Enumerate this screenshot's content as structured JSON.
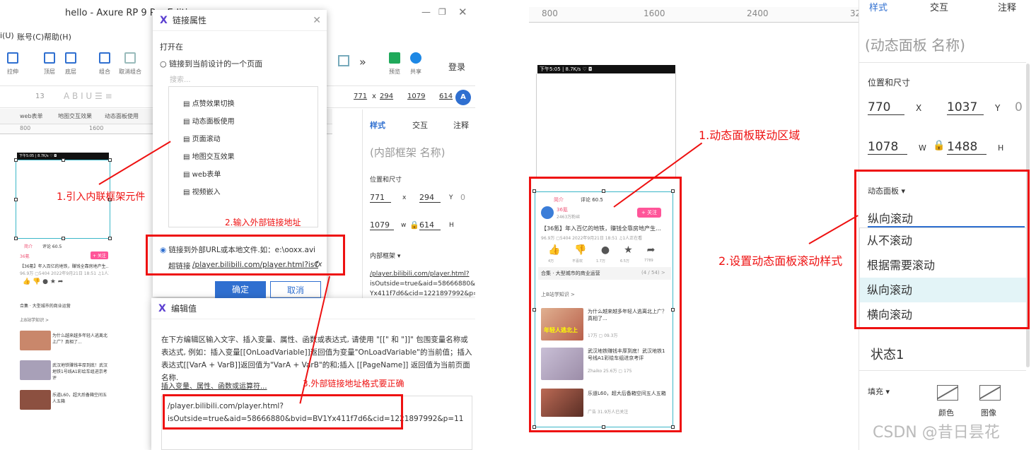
{
  "left": {
    "window_title": "hello - Axure RP 9 Pro Editi",
    "menu": [
      "i(U)",
      "账号(C)",
      "帮助(H)"
    ],
    "toolbar": [
      "拉伸",
      "顶层",
      "底层",
      "组合",
      "取消组合",
      "预览",
      "共享"
    ],
    "login": "登录",
    "fmt": {
      "size": "13",
      "x": "771",
      "y": "294",
      "w": "1079",
      "h": "614"
    },
    "tabs": [
      "web表单",
      "地图交互效果",
      "动态面板使用"
    ],
    "ruler": [
      "800",
      "1600"
    ],
    "props": {
      "tabs": [
        "样式",
        "交互",
        "注释"
      ],
      "name_placeholder": "(内部框架 名称)",
      "pos_label": "位置和尺寸",
      "x": "771",
      "x_lbl": "x",
      "y": "294",
      "y_lbl": "Y",
      "zero": "0",
      "w": "1079",
      "w_lbl": "w",
      "h": "614",
      "h_lbl": "H",
      "inner_label": "内部框架 ▾",
      "url_lines": [
        "/player.bilibili.com/player.html?",
        "isOutside=true&aid=58666880&bvid=E",
        "Yx411f7d6&cid=1221897992&p=11"
      ]
    },
    "link_dialog": {
      "title": "链接属性",
      "open_in": "打开在",
      "opt1": "链接到当前设计的一个页面",
      "search": "搜索...",
      "pages": [
        "点赞效果切换",
        "动态面板使用",
        "页面滚动",
        "地图交互效果",
        "web表单",
        "视频嵌入"
      ],
      "opt2": "链接到外部URL或本地文件.如：e:\\ooxx.avi",
      "hyperlink_label": "超链接",
      "hyperlink_value": "/player.bilibili.com/player.html?isOutside",
      "fx": "fx",
      "ok": "确定",
      "cancel": "取消"
    },
    "edit_dialog": {
      "title": "编辑值",
      "desc": "在下方编辑区输入文字、插入变量、属性、函数或表达式, 请使用 \"[[\" 和 \"]]\" 包围变量名称或表达式, 例如：插入变量[[OnLoadVariable]]返回值为变量\"OnLoadVariable\"的当前值；插入表达式[[VarA + VarB]]返回值为\"VarA + VarB\"的和;插入 [[PageName]] 返回值为当前页面名称.",
      "insert_link": "插入变量、属性、函数或运算符...",
      "code_line1": "/player.bilibili.com/player.html?",
      "code_line2": "isOutside=true&aid=58666880&bvid=BV1Yx411f7d6&cid=1221897992&p=11"
    },
    "annotations": [
      "1.引入内联框架元件",
      "2.输入外部链接地址",
      "3.外部链接地址格式要正确"
    ],
    "phone_status": "下午5:05 | 8.7K/s ♡ ◘"
  },
  "right": {
    "ruler": [
      "800",
      "1600",
      "2400",
      "32"
    ],
    "props": {
      "tabs": [
        "样式",
        "交互",
        "注释"
      ],
      "name_placeholder": "(动态面板 名称)",
      "pos_label": "位置和尺寸",
      "x": "770",
      "x_lbl": "X",
      "y": "1037",
      "y_lbl": "Y",
      "zero": "0",
      "w": "1078",
      "w_lbl": "W",
      "h": "1488",
      "h_lbl": "H",
      "panel_label": "动态面板 ▾",
      "panel_value": "纵向滚动",
      "options": [
        "从不滚动",
        "根据需要滚动",
        "纵向滚动",
        "横向滚动"
      ],
      "state": "状态1",
      "fill_label": "填充 ▾",
      "fill_color": "颜色",
      "fill_image": "图像"
    },
    "annotations": [
      "1.动态面板联动区域",
      "2.设置动态面板滚动样式"
    ],
    "phone_status": "下午5:05 | 8.7K/s ♡ ◘",
    "watermark": "CSDN @昔日昙花"
  },
  "feed": {
    "tabs": [
      "简介",
      "评论 60.5"
    ],
    "channel": "36氪",
    "channel_sub": "2463万粉丝",
    "follow": "+ 关注",
    "headline": "【36氪】年入百亿的地铁，赚钱全靠房地产生...",
    "meta": "96.9万 ▢5404 2022年9月21日 18:51 ♫1人正在看",
    "actions": [
      "4万",
      "不喜欢",
      "1.7万",
      "6.5万",
      "7789"
    ],
    "playlist": "合集 · 大型城市的商业运营",
    "playlist_count": "(4 / 54) >",
    "more": "上B站学知识 >",
    "items": [
      {
        "title": "为什么越来越多年轻人逃离北上广？真相了...",
        "meta": "17万 ▢ 09.3万"
      },
      {
        "title": "武汉地铁赚钱丰厚到底！武汉地铁1号线A1彩绘车组进京考评",
        "meta": "Zhaiko  25.6万 ▢ 175"
      },
      {
        "title": "乐道L60，超大后备箱空间五人五箱",
        "meta": "广告  31.9万人已关注"
      }
    ],
    "thumb_caption": "年轻人逃北上"
  },
  "colors": {
    "red": "#e11111",
    "accent": "#2f6fd0",
    "axure": "#5b3fd0",
    "panel_border": "#3bb7c8"
  }
}
